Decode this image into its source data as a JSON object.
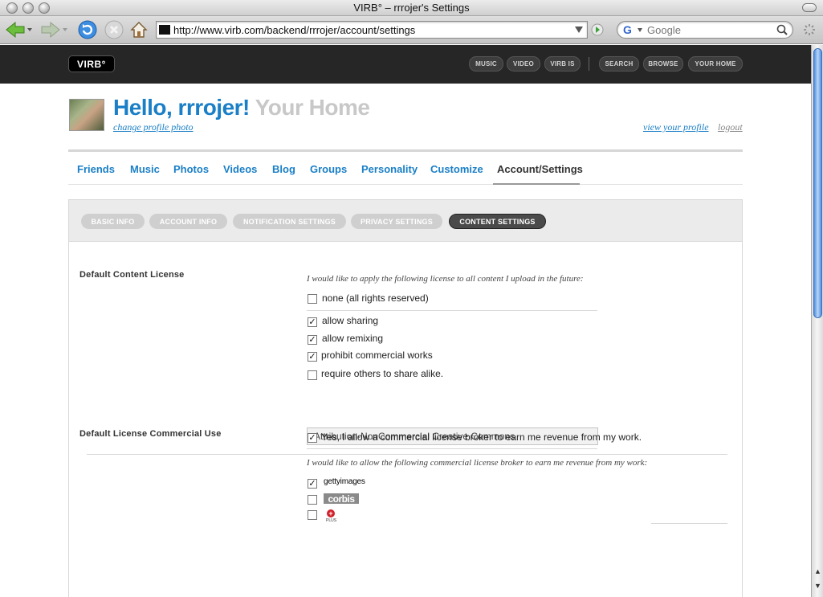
{
  "window": {
    "title": "VIRB° – rrrojer's Settings"
  },
  "browser": {
    "url": "http://www.virb.com/backend/rrrojer/account/settings",
    "search_engine": "G",
    "search_placeholder": "Google"
  },
  "site": {
    "logo": "VIRB°",
    "nav_left": [
      "MUSIC",
      "VIDEO",
      "VIRB IS"
    ],
    "nav_right": [
      "SEARCH",
      "BROWSE",
      "YOUR HOME"
    ]
  },
  "profile": {
    "greeting": "Hello, rrrojer!",
    "home_label": "Your Home",
    "change_photo": "change profile photo",
    "view_profile": "view your profile",
    "logout": "logout"
  },
  "tabs": [
    "Friends",
    "Music",
    "Photos",
    "Videos",
    "Blog",
    "Groups",
    "Personality",
    "Customize",
    "Account/Settings"
  ],
  "active_tab": "Account/Settings",
  "subnav": [
    "BASIC INFO",
    "ACCOUNT INFO",
    "NOTIFICATION SETTINGS",
    "PRIVACY SETTINGS",
    "CONTENT SETTINGS"
  ],
  "active_subnav": "CONTENT SETTINGS",
  "content_license": {
    "label": "Default Content License",
    "intro": "I would like to apply the following license to all content I upload in the future:",
    "options": [
      {
        "label": "none (all rights reserved)",
        "checked": false
      },
      {
        "label": "allow sharing",
        "checked": true
      },
      {
        "label": "allow remixing",
        "checked": true
      },
      {
        "label": "prohibit commercial works",
        "checked": true
      },
      {
        "label": "require others to share alike.",
        "checked": false
      }
    ],
    "result": "Attribution-NonCommercial Creative Commons"
  },
  "commercial_use": {
    "label": "Default License Commercial Use",
    "allow_label": "Yes, I allow a commercial license broker to earn me revenue from my work.",
    "allow_checked": true,
    "intro": "I would like to allow the following commercial license broker to earn me revenue from my work:",
    "brokers": [
      {
        "name": "gettyimages",
        "checked": true
      },
      {
        "name": "corbis",
        "checked": false
      },
      {
        "name": "PLUS",
        "checked": false
      }
    ]
  },
  "colors": {
    "link_blue": "#1a7fc6",
    "header_dark": "#262626",
    "home_gray": "#c8c8c8"
  }
}
